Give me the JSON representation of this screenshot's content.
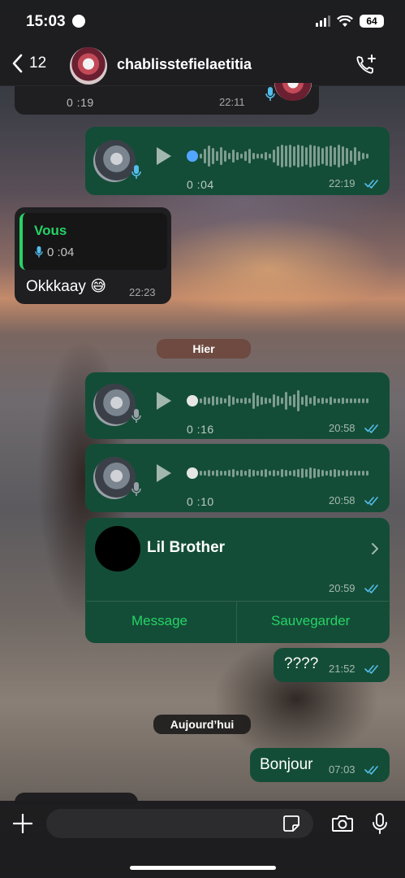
{
  "status_bar": {
    "time": "15:03",
    "battery": "64"
  },
  "header": {
    "back_count": "12",
    "contact_name": "chablisstefielaetitia"
  },
  "messages": {
    "top_partial": {
      "duration": "0 :19",
      "time": "22:11"
    },
    "voice1": {
      "duration": "0 :04",
      "time": "22:19"
    },
    "reply": {
      "quoted_name": "Vous",
      "quoted_duration": "0 :04",
      "text": "Okkkaay 😅",
      "time": "22:23"
    },
    "day_yesterday": "Hier",
    "voice2": {
      "duration": "0 :16",
      "time": "20:58"
    },
    "voice3": {
      "duration": "0 :10",
      "time": "20:58"
    },
    "contact_card": {
      "name": "Lil Brother",
      "time": "20:59",
      "message_label": "Message",
      "save_label": "Sauvegarder"
    },
    "question": {
      "text": "????",
      "time": "21:52"
    },
    "day_today": "Aujourd’hui",
    "bonjour": {
      "text": "Bonjour",
      "time": "07:03"
    }
  },
  "input": {
    "placeholder": ""
  },
  "colors": {
    "outgoing_bubble": "#144d37",
    "incoming_bubble": "#1f1f21",
    "accent_green": "#25d366",
    "read_ticks": "#53bdeb",
    "unplayed_dot": "#53a6ff"
  },
  "icons": [
    "back-chevron-icon",
    "call-add-icon",
    "mic-icon",
    "play-icon",
    "double-check-icon",
    "chevron-right-icon",
    "plus-icon",
    "sticker-icon",
    "camera-icon",
    "microphone-icon"
  ]
}
